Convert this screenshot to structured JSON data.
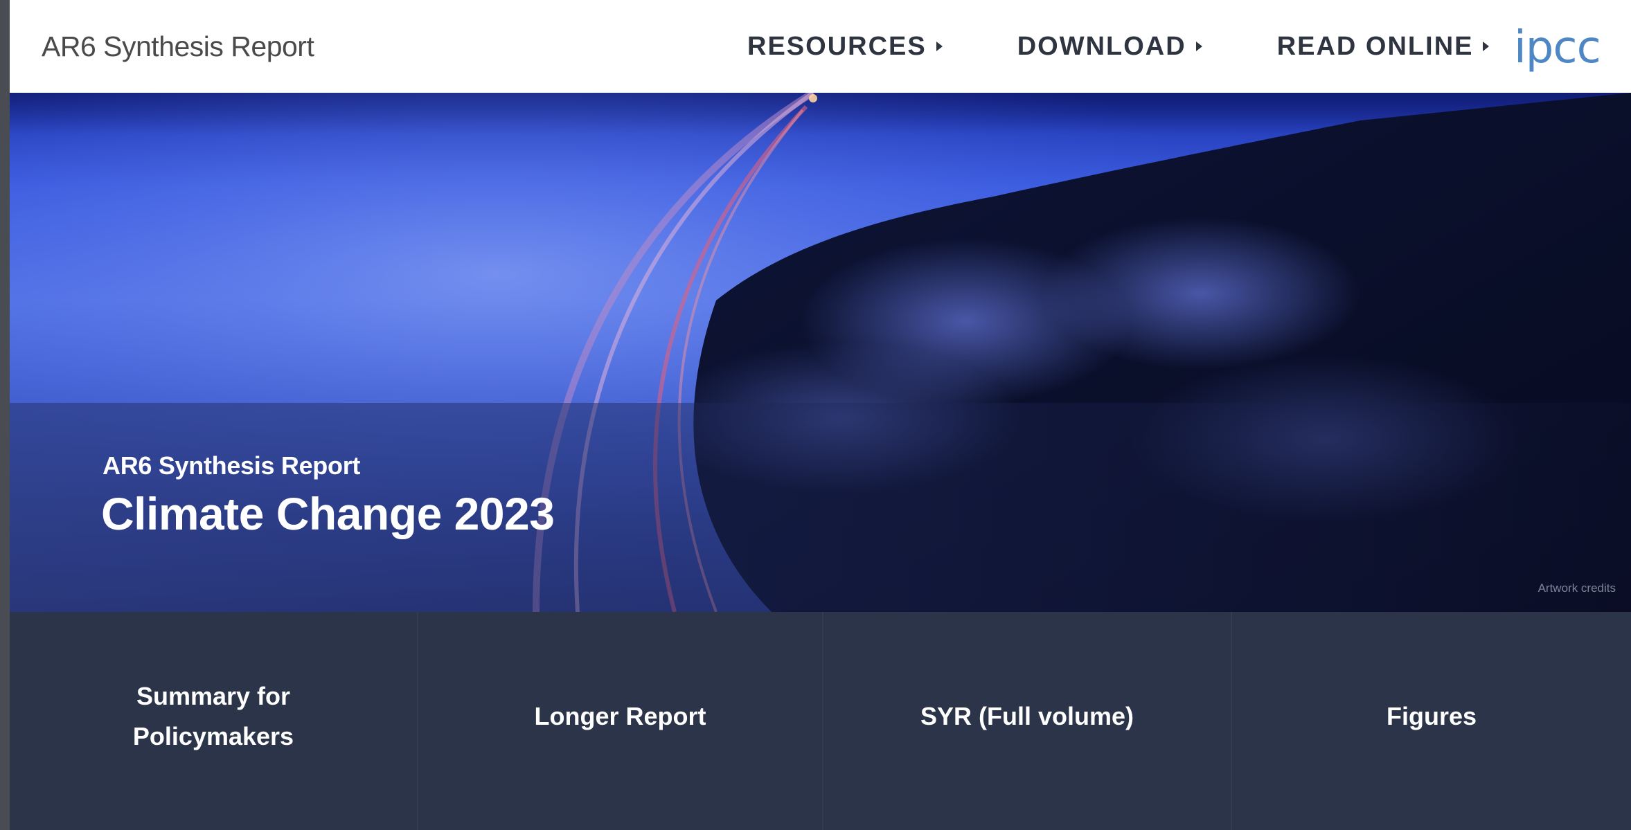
{
  "header": {
    "brand": "AR6 Synthesis Report",
    "nav": [
      {
        "label": "RESOURCES"
      },
      {
        "label": "DOWNLOAD"
      },
      {
        "label": "READ ONLINE"
      }
    ],
    "logo_text": "ipcc"
  },
  "hero": {
    "subtitle": "AR6 Synthesis Report",
    "title": "Climate Change 2023",
    "credit": "Artwork credits"
  },
  "cards": [
    {
      "label": "Summary for Policymakers"
    },
    {
      "label": "Longer Report"
    },
    {
      "label": "SYR (Full volume)"
    },
    {
      "label": "Figures"
    }
  ],
  "colors": {
    "header_bg": "#ffffff",
    "logo": "#4f87c4",
    "cards_bg": "#2b3448",
    "hero_blue": "#3a5be0"
  }
}
